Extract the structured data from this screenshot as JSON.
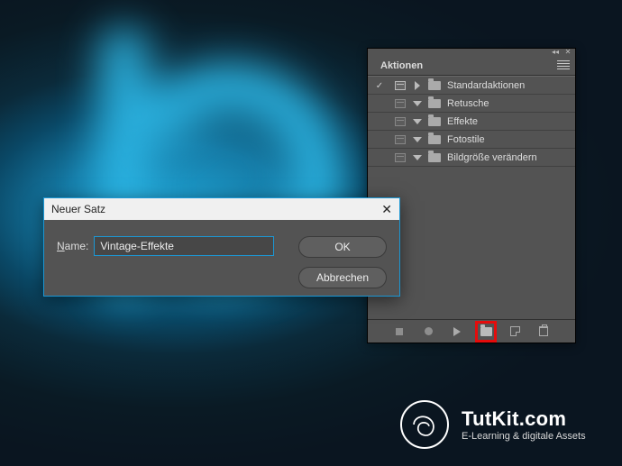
{
  "panel": {
    "tab_label": "Aktionen",
    "sets": [
      {
        "label": "Standardaktionen",
        "checked": true,
        "dialog": "full",
        "twist": "right"
      },
      {
        "label": "Retusche",
        "checked": false,
        "dialog": "dim",
        "twist": "down"
      },
      {
        "label": "Effekte",
        "checked": false,
        "dialog": "dim",
        "twist": "down"
      },
      {
        "label": "Fotostile",
        "checked": false,
        "dialog": "dim",
        "twist": "down"
      },
      {
        "label": "Bildgröße verändern",
        "checked": false,
        "dialog": "dim",
        "twist": "down"
      }
    ],
    "foot_icons": [
      "stop",
      "record",
      "play",
      "new-set",
      "new-action",
      "trash"
    ]
  },
  "dialog": {
    "title": "Neuer Satz",
    "name_label_pre": "N",
    "name_label_post": "ame:",
    "name_value": "Vintage-Effekte",
    "ok": "OK",
    "cancel": "Abbrechen"
  },
  "brand": {
    "name": "TutKit.com",
    "tagline": "E-Learning & digitale Assets"
  }
}
